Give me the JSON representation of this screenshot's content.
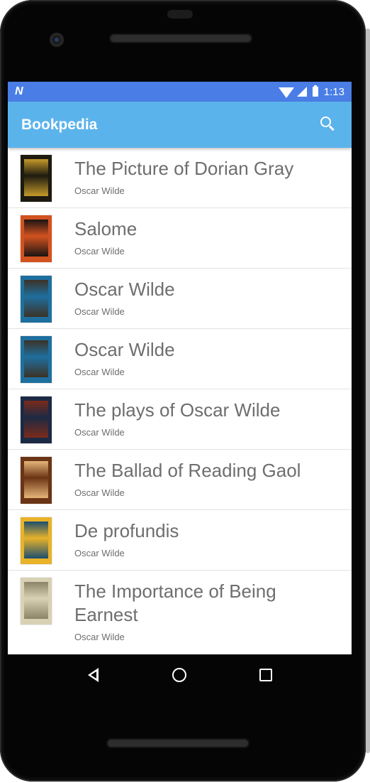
{
  "status_bar": {
    "notification_icon": "N",
    "time": "1:13",
    "icons": [
      "n-notification-icon",
      "wifi-icon",
      "signal-icon",
      "battery-icon"
    ]
  },
  "app_bar": {
    "title": "Bookpedia",
    "search_icon": "search-icon"
  },
  "books": [
    {
      "title": "The Picture of Dorian Gray",
      "author": "Oscar Wilde",
      "cover_colors": [
        "#1d1a10",
        "#c59a2a"
      ]
    },
    {
      "title": "Salome",
      "author": "Oscar Wilde",
      "cover_colors": [
        "#d2521f",
        "#1c1412"
      ]
    },
    {
      "title": "Oscar Wilde",
      "author": "Oscar Wilde",
      "cover_colors": [
        "#1f6f9e",
        "#3b3226"
      ]
    },
    {
      "title": "Oscar Wilde",
      "author": "Oscar Wilde",
      "cover_colors": [
        "#1f6f9e",
        "#3b3226"
      ]
    },
    {
      "title": "The plays of Oscar Wilde",
      "author": "Oscar Wilde",
      "cover_colors": [
        "#1d2a44",
        "#7b2a1a"
      ]
    },
    {
      "title": "The Ballad of Reading Gaol",
      "author": "Oscar Wilde",
      "cover_colors": [
        "#6b3414",
        "#e5b57a"
      ]
    },
    {
      "title": "De profundis",
      "author": "Oscar Wilde",
      "cover_colors": [
        "#e8b22a",
        "#1b4e6e"
      ]
    },
    {
      "title": "The Importance of Being Earnest",
      "author": "Oscar Wilde",
      "cover_colors": [
        "#d9d1b3",
        "#8c8468"
      ]
    }
  ],
  "nav_bar": {
    "back_icon": "back-icon",
    "home_icon": "home-icon",
    "recents_icon": "recents-icon"
  },
  "colors": {
    "status_bar": "#4a7ee6",
    "app_bar": "#5bb3ec",
    "text": "#6e6e6e"
  }
}
